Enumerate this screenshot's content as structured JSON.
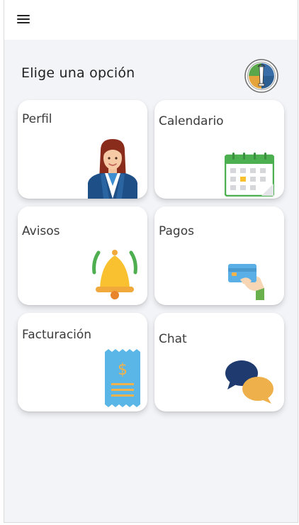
{
  "header": {
    "menu_icon": "hamburger-menu-icon"
  },
  "page": {
    "title": "Elige una opción",
    "logo_icon": "institution-logo-icon"
  },
  "options": [
    {
      "label": "Perfil",
      "icon": "profile-avatar-icon"
    },
    {
      "label": "Calendario",
      "icon": "calendar-icon"
    },
    {
      "label": "Avisos",
      "icon": "bell-icon"
    },
    {
      "label": "Pagos",
      "icon": "credit-card-icon"
    },
    {
      "label": "Facturación",
      "icon": "invoice-receipt-icon"
    },
    {
      "label": "Chat",
      "icon": "chat-bubbles-icon"
    }
  ],
  "colors": {
    "background": "#f3f4f8",
    "card": "#ffffff",
    "calendar_green": "#4caf50",
    "bell_yellow": "#f9c02f",
    "receipt_blue": "#5ab6e6",
    "chat_navy": "#1e3a6e",
    "chat_yellow": "#eeb04a"
  }
}
